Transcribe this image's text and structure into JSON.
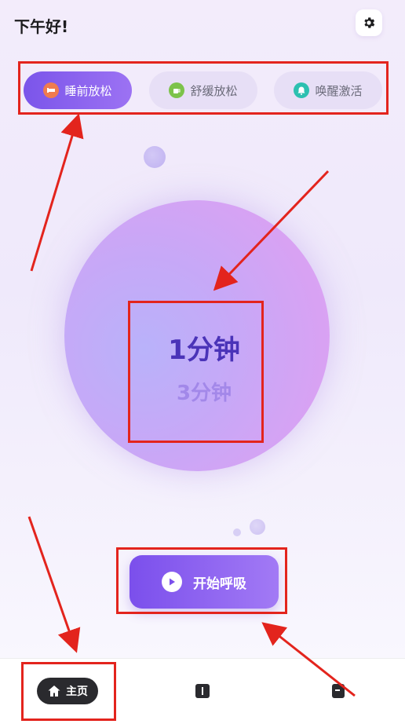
{
  "header": {
    "greeting": "下午好!"
  },
  "tabs": [
    {
      "label": "睡前放松",
      "icon": "bed-icon",
      "active": true,
      "icon_color": "#f07b4e"
    },
    {
      "label": "舒缓放松",
      "icon": "cup-icon",
      "active": false,
      "icon_color": "#7cc34a"
    },
    {
      "label": "唤醒激活",
      "icon": "alarm-icon",
      "active": false,
      "icon_color": "#2cc0b0"
    }
  ],
  "timer": {
    "main": "1分钟",
    "sub": "3分钟"
  },
  "start_button": {
    "label": "开始呼吸"
  },
  "bottom_nav": {
    "home_label": "主页",
    "items": [
      "home-icon",
      "book-icon",
      "document-icon"
    ]
  },
  "colors": {
    "accent": "#7b55ea",
    "annotation": "#e3241d"
  }
}
